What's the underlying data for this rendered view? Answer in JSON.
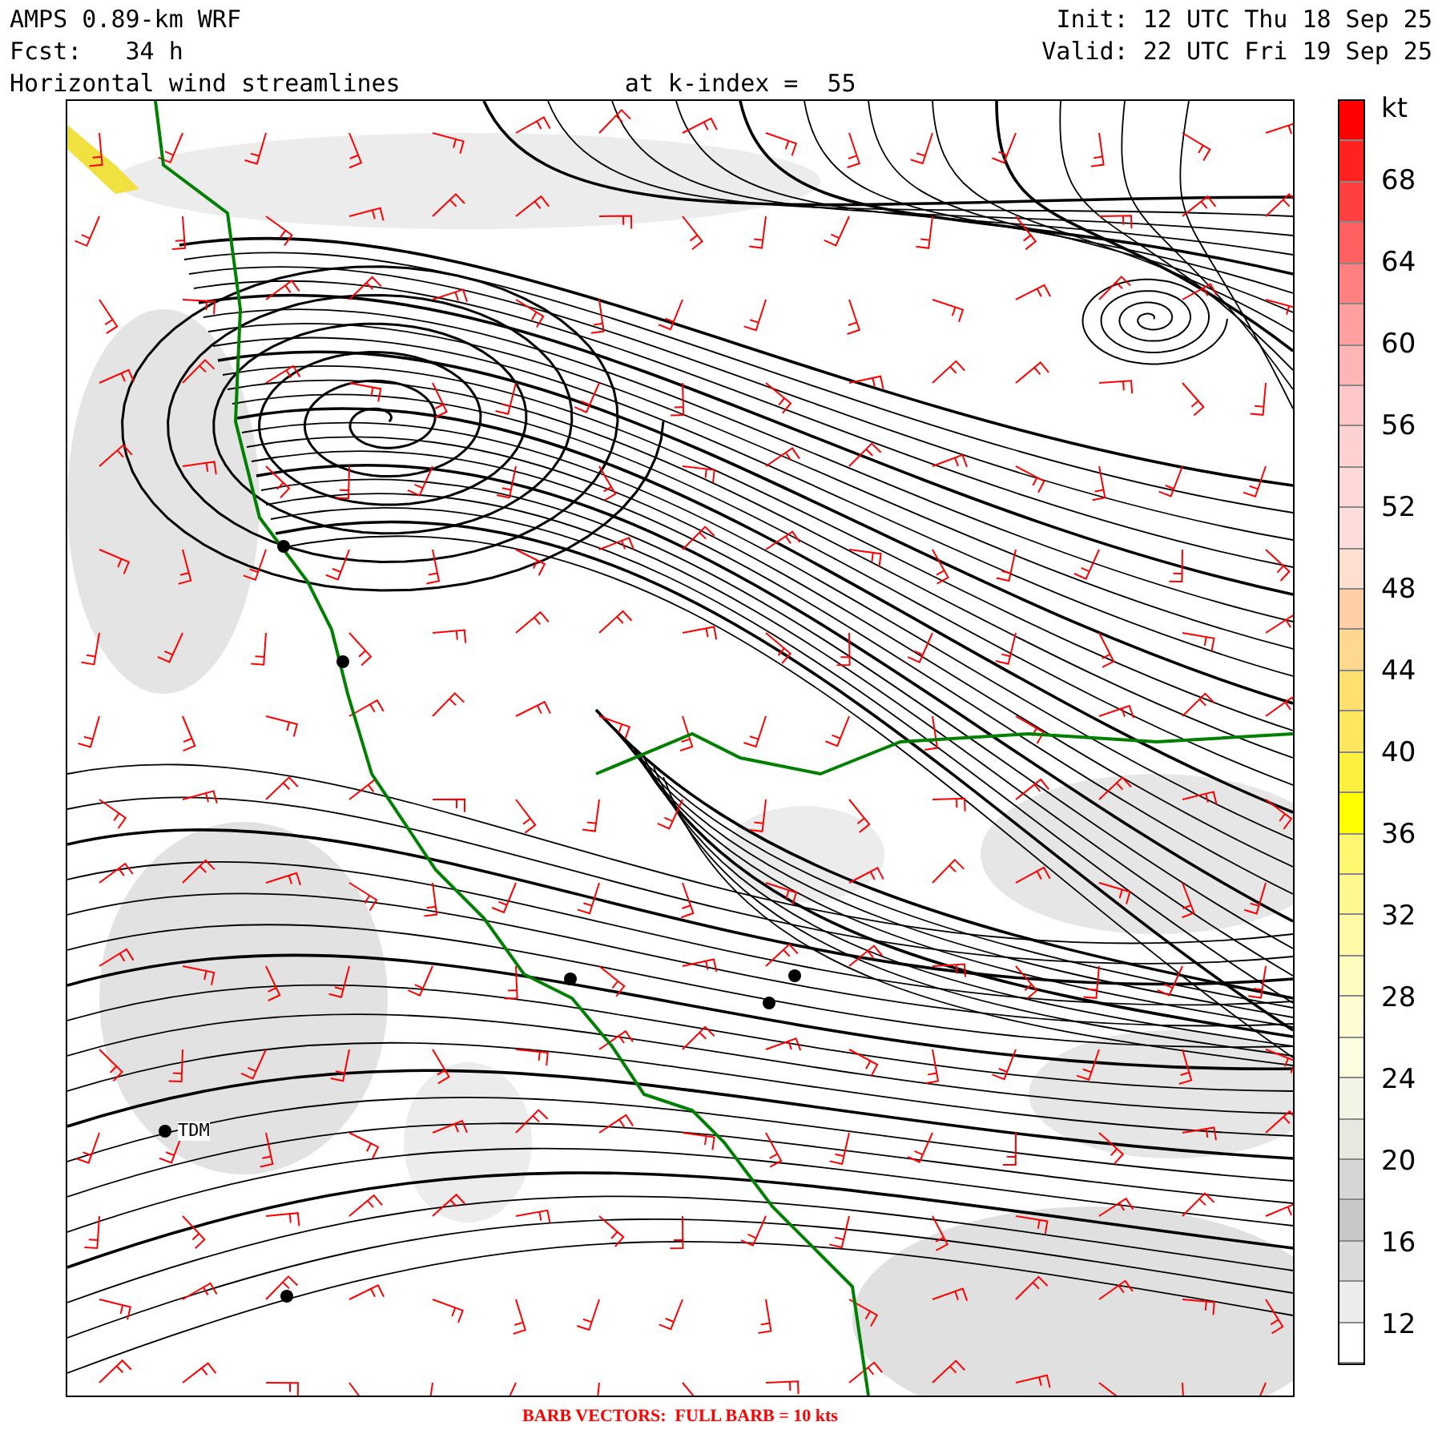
{
  "header": {
    "model": "AMPS 0.89-km WRF",
    "forecast": "Fcst:   34 h",
    "field": "Horizontal wind streamlines",
    "level": "at k-index =  55",
    "init": "Init: 12 UTC Thu 18 Sep 25",
    "valid": "Valid: 22 UTC Fri 19 Sep 25"
  },
  "map": {
    "station_label": "TDM"
  },
  "colorbar": {
    "unit": "kt",
    "labels": [
      "68",
      "64",
      "60",
      "56",
      "52",
      "48",
      "44",
      "40",
      "36",
      "32",
      "28",
      "24",
      "20",
      "16",
      "12"
    ],
    "bands": [
      {
        "color": "#ff0000"
      },
      {
        "color": "#ff2020"
      },
      {
        "color": "#ff4040"
      },
      {
        "color": "#ff6060"
      },
      {
        "color": "#ff8080"
      },
      {
        "color": "#ff9f9f"
      },
      {
        "color": "#ffb5b5"
      },
      {
        "color": "#ffc8c8"
      },
      {
        "color": "#ffd2d2"
      },
      {
        "color": "#ffd8d8"
      },
      {
        "color": "#ffdcdc"
      },
      {
        "color": "#ffe0d0"
      },
      {
        "color": "#ffcfa8"
      },
      {
        "color": "#ffd890"
      },
      {
        "color": "#ffe070"
      },
      {
        "color": "#ffe860"
      },
      {
        "color": "#fff040"
      },
      {
        "color": "#ffff00"
      },
      {
        "color": "#fff870"
      },
      {
        "color": "#fff890"
      },
      {
        "color": "#fffaa8"
      },
      {
        "color": "#fffcc0"
      },
      {
        "color": "#fffcd2"
      },
      {
        "color": "#fcfce0"
      },
      {
        "color": "#f4f4e6"
      },
      {
        "color": "#e8e8e0"
      },
      {
        "color": "#d6d6d6"
      },
      {
        "color": "#c8c8c8"
      },
      {
        "color": "#dadada"
      },
      {
        "color": "#ececec"
      },
      {
        "color": "#ffffff"
      }
    ]
  },
  "caption": "BARB VECTORS:  FULL BARB = 10 kts"
}
